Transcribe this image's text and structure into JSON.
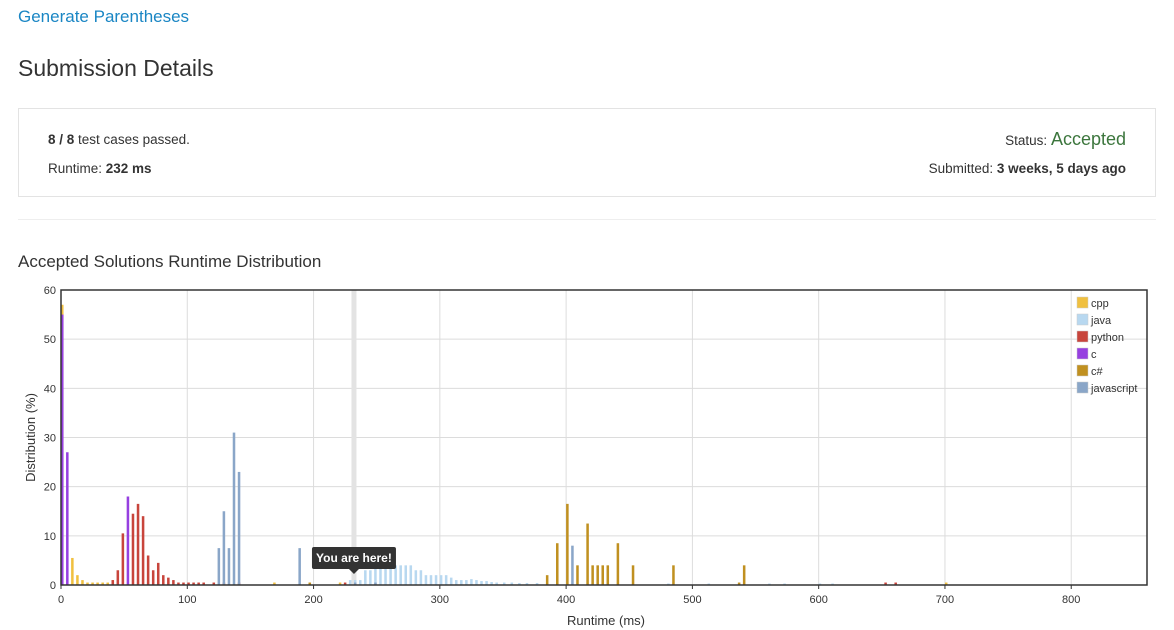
{
  "problem_title": "Generate Parentheses",
  "page_title": "Submission Details",
  "details": {
    "passed": "8",
    "sep": " / ",
    "total": "8",
    "passed_suffix": " test cases passed.",
    "runtime_label": "Runtime: ",
    "runtime_value": "232 ms",
    "status_label": "Status: ",
    "status_value": "Accepted",
    "submitted_label": "Submitted: ",
    "submitted_value": "3 weeks, 5 days ago"
  },
  "chart_title": "Accepted Solutions Runtime Distribution",
  "tooltip": "You are here!",
  "chart_data": {
    "type": "bar",
    "xlabel": "Runtime (ms)",
    "ylabel": "Distribution (%)",
    "xlim": [
      0,
      860
    ],
    "ylim": [
      0,
      60
    ],
    "xticks": [
      0,
      100,
      200,
      300,
      400,
      500,
      600,
      700,
      800
    ],
    "yticks": [
      0,
      10,
      20,
      30,
      40,
      50,
      60
    ],
    "grid": true,
    "legend": "top-right",
    "highlight_x": 232,
    "bar_width": 2,
    "series": [
      {
        "name": "cpp",
        "color": "#f0c040",
        "points": [
          [
            0,
            57
          ],
          [
            8,
            5.5
          ],
          [
            12,
            2
          ],
          [
            16,
            1
          ],
          [
            20,
            0.5
          ],
          [
            24,
            0.5
          ],
          [
            28,
            0.5
          ],
          [
            32,
            0.5
          ],
          [
            36,
            0.5
          ],
          [
            40,
            1
          ],
          [
            168,
            0.5
          ],
          [
            220,
            0.5
          ],
          [
            232,
            0.5
          ],
          [
            700,
            0.5
          ]
        ]
      },
      {
        "name": "java",
        "color": "#b8d8f0",
        "points": [
          [
            228,
            1
          ],
          [
            232,
            1
          ],
          [
            236,
            1
          ],
          [
            240,
            3
          ],
          [
            244,
            3
          ],
          [
            248,
            4
          ],
          [
            252,
            6
          ],
          [
            256,
            6
          ],
          [
            260,
            5
          ],
          [
            264,
            4
          ],
          [
            268,
            4
          ],
          [
            272,
            4
          ],
          [
            276,
            4
          ],
          [
            280,
            3
          ],
          [
            284,
            3
          ],
          [
            288,
            2
          ],
          [
            292,
            2
          ],
          [
            296,
            2
          ],
          [
            300,
            2
          ],
          [
            304,
            2
          ],
          [
            308,
            1.5
          ],
          [
            312,
            1
          ],
          [
            316,
            1
          ],
          [
            320,
            1
          ],
          [
            324,
            1.2
          ],
          [
            328,
            1
          ],
          [
            332,
            0.8
          ],
          [
            336,
            0.8
          ],
          [
            340,
            0.6
          ],
          [
            344,
            0.5
          ],
          [
            350,
            0.5
          ],
          [
            356,
            0.5
          ],
          [
            362,
            0.4
          ],
          [
            368,
            0.4
          ],
          [
            376,
            0.4
          ],
          [
            384,
            0.3
          ],
          [
            392,
            0.3
          ],
          [
            420,
            0.2
          ],
          [
            480,
            0.3
          ],
          [
            512,
            0.3
          ],
          [
            560,
            0.3
          ],
          [
            572,
            0.3
          ],
          [
            600,
            0.3
          ],
          [
            610,
            0.3
          ]
        ]
      },
      {
        "name": "python",
        "color": "#c8453c",
        "points": [
          [
            40,
            1
          ],
          [
            44,
            3
          ],
          [
            48,
            10.5
          ],
          [
            56,
            14.5
          ],
          [
            60,
            16.5
          ],
          [
            64,
            14
          ],
          [
            68,
            6
          ],
          [
            72,
            3
          ],
          [
            76,
            4.5
          ],
          [
            80,
            2
          ],
          [
            84,
            1.5
          ],
          [
            88,
            1
          ],
          [
            92,
            0.5
          ],
          [
            96,
            0.5
          ],
          [
            100,
            0.5
          ],
          [
            104,
            0.5
          ],
          [
            108,
            0.5
          ],
          [
            112,
            0.5
          ],
          [
            120,
            0.5
          ],
          [
            128,
            0.5
          ],
          [
            140,
            0.5
          ],
          [
            224,
            0.5
          ],
          [
            652,
            0.5
          ],
          [
            660,
            0.5
          ]
        ]
      },
      {
        "name": "c",
        "color": "#9640e0",
        "points": [
          [
            0,
            55
          ],
          [
            4,
            27
          ],
          [
            52,
            18
          ]
        ]
      },
      {
        "name": "c#",
        "color": "#c09020",
        "points": [
          [
            196,
            0.5
          ],
          [
            384,
            2
          ],
          [
            392,
            8.5
          ],
          [
            400,
            16.5
          ],
          [
            408,
            4
          ],
          [
            416,
            12.5
          ],
          [
            420,
            4
          ],
          [
            424,
            4
          ],
          [
            428,
            4
          ],
          [
            432,
            4
          ],
          [
            440,
            8.5
          ],
          [
            452,
            4
          ],
          [
            484,
            4
          ],
          [
            536,
            0.5
          ],
          [
            540,
            4
          ]
        ]
      },
      {
        "name": "javascript",
        "color": "#8aa6c8",
        "points": [
          [
            124,
            7.5
          ],
          [
            128,
            15
          ],
          [
            132,
            7.5
          ],
          [
            136,
            31
          ],
          [
            140,
            23
          ],
          [
            188,
            7.5
          ],
          [
            232,
            0.5
          ],
          [
            248,
            0.5
          ],
          [
            404,
            8
          ]
        ]
      }
    ]
  }
}
